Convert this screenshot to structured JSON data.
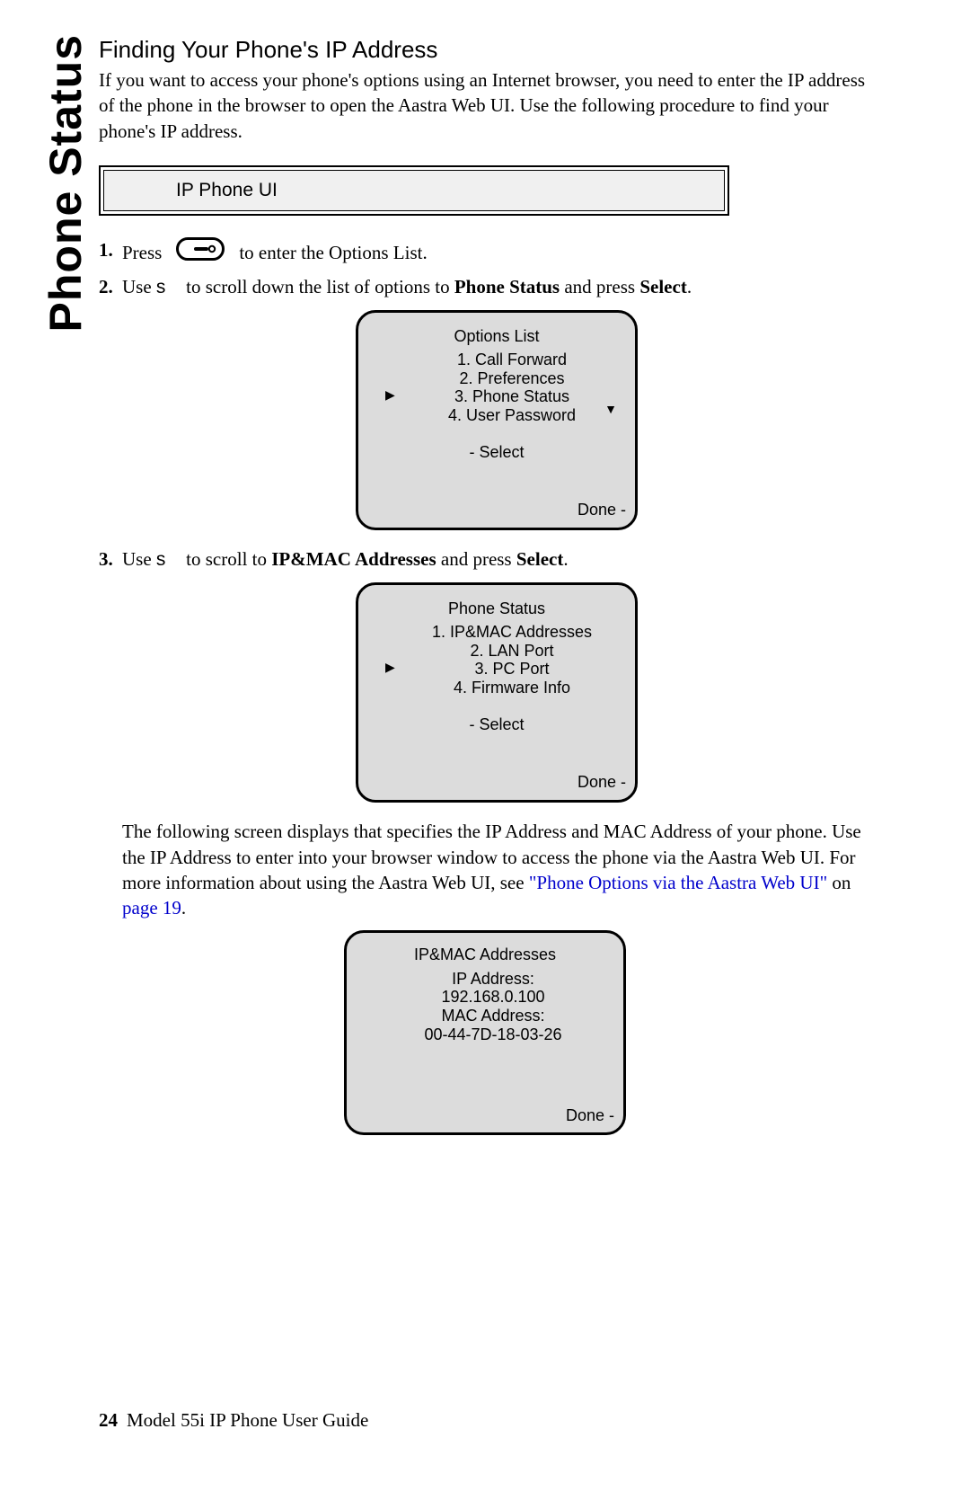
{
  "side_title": "Phone Status",
  "section_title": "Finding Your Phone's IP Address",
  "intro": "If you want to access your phone's options using an Internet browser, you need to enter the IP address of the phone in the browser to open the Aastra Web UI. Use the following procedure to find your phone's IP address.",
  "ui_box_label": "IP Phone UI",
  "steps": {
    "s1_pre": "Press",
    "s1_post": " to enter the Options List.",
    "s2_pre": "Use ",
    "s2_key": "s",
    "s2_mid": " to scroll down the list of options to ",
    "s2_bold": "Phone Status",
    "s2_mid2": " and press ",
    "s2_bold2": "Select",
    "s2_end": ".",
    "s3_pre": "Use ",
    "s3_key": "s",
    "s3_mid": " to scroll to ",
    "s3_bold": "IP&MAC Addresses",
    "s3_mid2": " and press ",
    "s3_bold2": "Select",
    "s3_end": "."
  },
  "screen1": {
    "title": "Options List",
    "item1": "1. Call Forward",
    "item2": "2. Preferences",
    "item3": "3. Phone Status",
    "item4": "4. User Password",
    "select": "- Select",
    "done": "Done -"
  },
  "screen2": {
    "title": "Phone Status",
    "item1": "1. IP&MAC Addresses",
    "item2": "2. LAN Port",
    "item3": "3. PC Port",
    "item4": "4. Firmware Info",
    "select": "- Select",
    "done": "Done -"
  },
  "para2a": "The following screen displays that specifies the IP Address and MAC Address of your phone. Use the IP Address to enter into your browser window to access the phone via the Aastra Web UI. For more information about using the Aastra Web UI, see ",
  "link1": "\"Phone Options via the Aastra Web UI\"",
  "para2b": " on ",
  "link2": "page 19",
  "para2c": ".",
  "screen3": {
    "title": "IP&MAC Addresses",
    "l1": "IP Address:",
    "l2": "192.168.0.100",
    "l3": "MAC Address:",
    "l4": "00-44-7D-18-03-26",
    "done": "Done -"
  },
  "footer": {
    "page": "24",
    "text": "Model 55i IP Phone User Guide"
  }
}
